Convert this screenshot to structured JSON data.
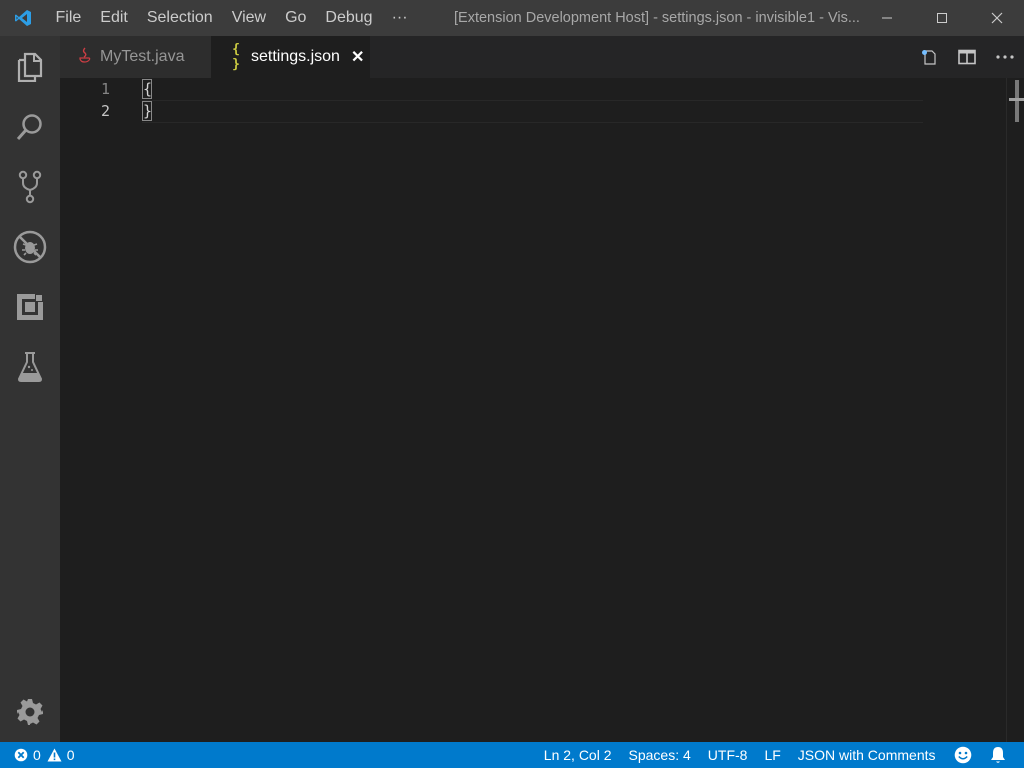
{
  "menu": [
    "File",
    "Edit",
    "Selection",
    "View",
    "Go",
    "Debug",
    "···"
  ],
  "window_title": "[Extension Development Host] - settings.json - invisible1 - Vis...",
  "tabs": [
    {
      "label": "MyTest.java",
      "icon": "java-icon",
      "active": false
    },
    {
      "label": "settings.json",
      "icon": "{ }",
      "active": true
    }
  ],
  "editor": {
    "line_numbers": [
      "1",
      "2"
    ],
    "lines": [
      "{",
      "}"
    ]
  },
  "status": {
    "errors": "0",
    "warnings": "0",
    "position": "Ln 2, Col 2",
    "indent": "Spaces: 4",
    "encoding": "UTF-8",
    "eol": "LF",
    "language": "JSON with Comments"
  },
  "colors": {
    "accent": "#007acc",
    "activity_bar": "#333333",
    "title_bar": "#3c3c3c",
    "json_icon": "#cbcb41"
  }
}
